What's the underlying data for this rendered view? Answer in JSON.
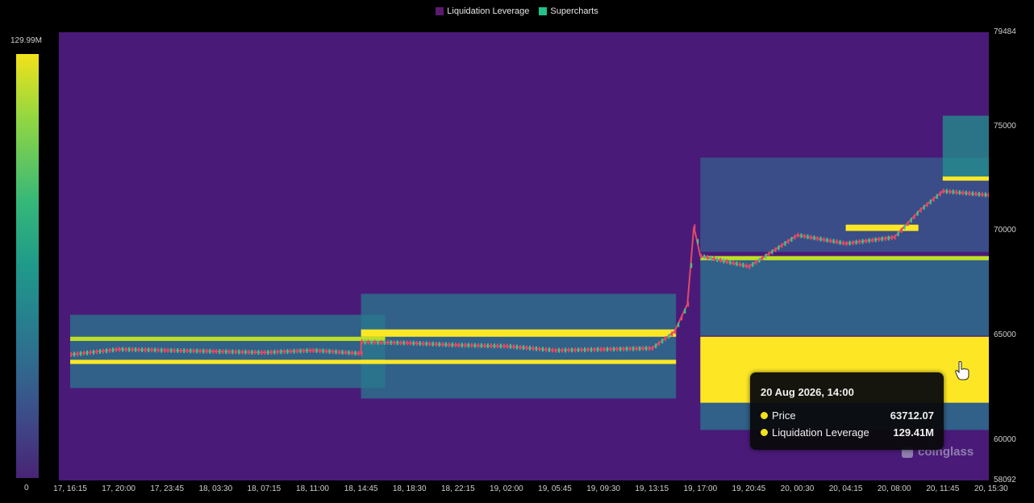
{
  "legend": [
    {
      "label": "Liquidation Leverage",
      "color": "#5b1a6e"
    },
    {
      "label": "Supercharts",
      "color": "#22c28a"
    }
  ],
  "colorbar": {
    "max_label": "129.99M",
    "min_label": "0"
  },
  "tooltip": {
    "title": "20 Aug 2026, 14:00",
    "rows": [
      {
        "label": "Price",
        "value": "63712.07",
        "dot_color": "#f2e21b"
      },
      {
        "label": "Liquidation Leverage",
        "value": "129.41M",
        "dot_color": "#f2e21b"
      }
    ]
  },
  "watermark": "coinglass",
  "chart_data": {
    "type": "heatmap",
    "title": "",
    "series": [
      {
        "name": "Liquidation Leverage",
        "type": "heatmap"
      },
      {
        "name": "Supercharts",
        "type": "candlestick"
      }
    ],
    "y_axis": {
      "ticks": [
        "79484",
        "75000",
        "70000",
        "65000",
        "60000",
        "58092"
      ],
      "tick_values": [
        79484,
        75000,
        70000,
        65000,
        60000,
        58092
      ],
      "range": [
        58092,
        79484
      ]
    },
    "x_axis": {
      "ticks": [
        "17, 16:15",
        "17, 20:00",
        "17, 23:45",
        "18, 03:30",
        "18, 07:15",
        "18, 11:00",
        "18, 14:45",
        "18, 18:30",
        "18, 22:15",
        "19, 02:00",
        "19, 05:45",
        "19, 09:30",
        "19, 13:15",
        "19, 17:00",
        "19, 20:45",
        "20, 00:30",
        "20, 04:15",
        "20, 08:00",
        "20, 11:45",
        "20, 15:30"
      ]
    },
    "colorbar_range": [
      0,
      129990000
    ],
    "price_path": [
      {
        "t": "17, 16:15",
        "price": 64100
      },
      {
        "t": "17, 20:00",
        "price": 64350
      },
      {
        "t": "17, 23:45",
        "price": 64300
      },
      {
        "t": "18, 03:30",
        "price": 64250
      },
      {
        "t": "18, 07:15",
        "price": 64200
      },
      {
        "t": "18, 11:00",
        "price": 64300
      },
      {
        "t": "18, 14:45",
        "price": 64150
      },
      {
        "t": "18, 14:45",
        "price": 64700
      },
      {
        "t": "18, 18:30",
        "price": 64650
      },
      {
        "t": "18, 22:15",
        "price": 64550
      },
      {
        "t": "19, 02:00",
        "price": 64500
      },
      {
        "t": "19, 05:45",
        "price": 64300
      },
      {
        "t": "19, 09:30",
        "price": 64350
      },
      {
        "t": "19, 13:15",
        "price": 64400
      },
      {
        "t": "19, 15:00",
        "price": 65200
      },
      {
        "t": "19, 16:00",
        "price": 66500
      },
      {
        "t": "19, 16:30",
        "price": 70200
      },
      {
        "t": "19, 17:00",
        "price": 68800
      },
      {
        "t": "19, 20:45",
        "price": 68300
      },
      {
        "t": "20, 00:30",
        "price": 69800
      },
      {
        "t": "20, 04:15",
        "price": 69400
      },
      {
        "t": "20, 08:00",
        "price": 69700
      },
      {
        "t": "20, 10:00",
        "price": 71000
      },
      {
        "t": "20, 11:45",
        "price": 71900
      },
      {
        "t": "20, 15:30",
        "price": 71700
      },
      {
        "t": "20, 16:30",
        "price": 72400
      }
    ],
    "liquidation_bands": [
      {
        "t_start": "17, 16:15",
        "t_end": "18, 14:45",
        "price_low": 64750,
        "price_high": 64950,
        "level": 0.85
      },
      {
        "t_start": "17, 16:15",
        "t_end": "18, 14:45",
        "price_low": 63650,
        "price_high": 63850,
        "level": 0.95
      },
      {
        "t_start": "18, 14:45",
        "t_end": "19, 13:15",
        "price_low": 64950,
        "price_high": 65300,
        "level": 1.0
      },
      {
        "t_start": "18, 14:45",
        "t_end": "19, 13:15",
        "price_low": 63650,
        "price_high": 63850,
        "level": 1.0
      },
      {
        "t_start": "19, 17:00",
        "t_end": "20, 15:30",
        "price_low": 61800,
        "price_high": 64950,
        "level": 1.0
      },
      {
        "t_start": "20, 04:15",
        "t_end": "20, 08:00",
        "price_low": 70000,
        "price_high": 70300,
        "level": 1.0
      },
      {
        "t_start": "19, 17:00",
        "t_end": "20, 15:30",
        "price_low": 68600,
        "price_high": 68800,
        "level": 0.9
      },
      {
        "t_start": "20, 11:45",
        "t_end": "20, 15:30",
        "price_low": 72400,
        "price_high": 72600,
        "level": 0.95
      }
    ]
  }
}
